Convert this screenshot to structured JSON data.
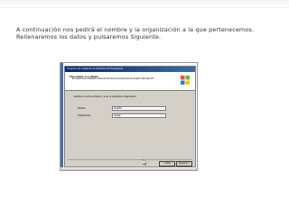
{
  "caption": {
    "line1": "A continuación nos pedirá el nombre y la organización a la que pertenecemos.",
    "line2": "Rellenaremos los datos y pulsaremos Siguiente."
  },
  "wizard": {
    "title": "Programa de instalación de Windows XP Professional",
    "header_title": "Personalice su software",
    "header_subtitle": "El programa de instalación usará la información personal para personalizar Windows XP",
    "prompt": "Escriba su nombre completo y el de su compañía u organización.",
    "name_label": "Nombre:",
    "name_value": "AulaClic",
    "org_label": "Organización:",
    "org_value": "Google",
    "back_label": "< Atrás",
    "next_label": "Siguiente >"
  }
}
